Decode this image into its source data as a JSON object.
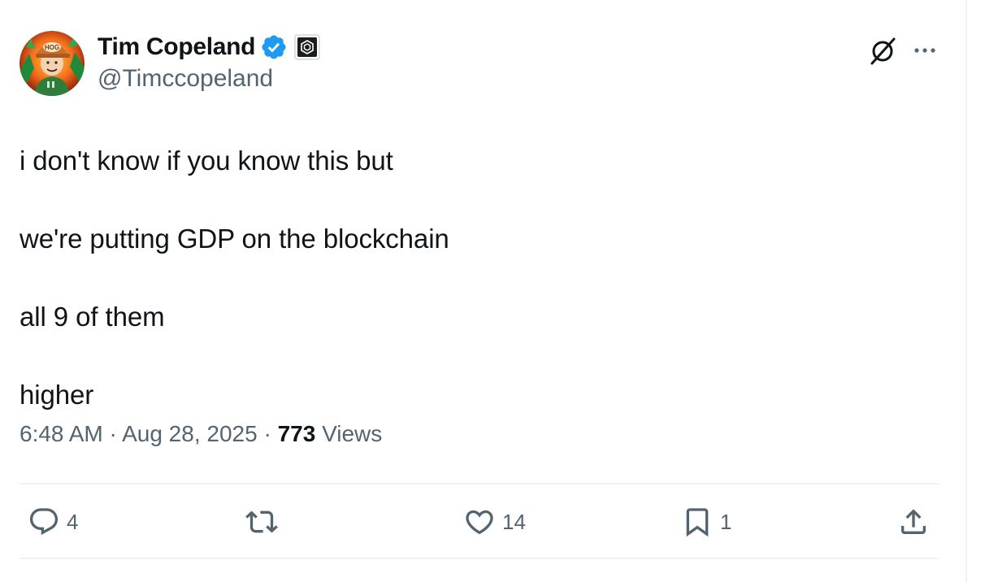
{
  "author": {
    "display_name": "Tim Copeland",
    "handle": "@Timccopeland",
    "avatar_cap_text": "HOG"
  },
  "tweet": {
    "lines": [
      "i don't know if you know this but",
      "we're putting GDP on the blockchain",
      "all 9 of them",
      "higher"
    ],
    "time": "6:48 AM",
    "separator": "·",
    "date": "Aug 28, 2025",
    "views_count": "773",
    "views_label": "Views"
  },
  "actions": {
    "replies": "4",
    "reposts": "",
    "likes": "14",
    "bookmarks": "1"
  },
  "icons": {
    "verified": "verified-badge-icon",
    "affiliate": "affiliate-badge-icon",
    "grok": "grok-icon",
    "more": "more-icon",
    "reply": "reply-icon",
    "repost": "repost-icon",
    "like": "like-icon",
    "bookmark": "bookmark-icon",
    "share": "share-icon"
  },
  "colors": {
    "verified_blue": "#1d9bf0",
    "text_primary": "#0f1419",
    "text_secondary": "#536471",
    "divider": "#eff3f4"
  }
}
